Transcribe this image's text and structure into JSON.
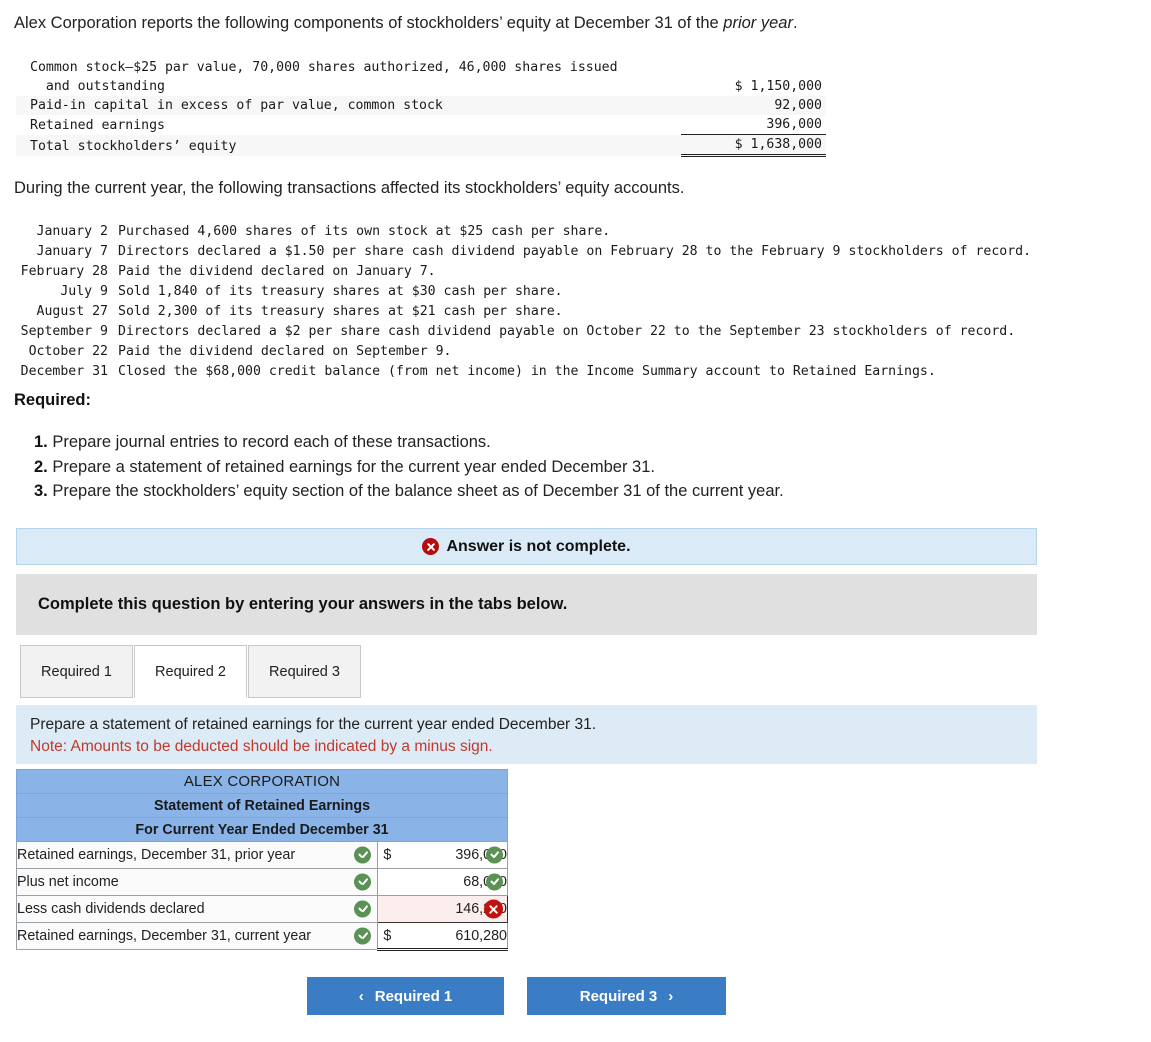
{
  "intro": {
    "text_before": "Alex Corporation reports the following components of stockholders’ equity at December 31 of the ",
    "italic": "prior year",
    "text_after": "."
  },
  "equity_table": {
    "rows": [
      {
        "label": "Common stock–$25 par value, 70,000 shares authorized, 46,000 shares issued",
        "amount": ""
      },
      {
        "label": "  and outstanding",
        "amount": "$ 1,150,000"
      },
      {
        "label": "Paid-in capital in excess of par value, common stock",
        "amount": "92,000"
      },
      {
        "label": "Retained earnings",
        "amount": "396,000"
      },
      {
        "label": "Total stockholders’ equity",
        "amount": "$ 1,638,000"
      }
    ]
  },
  "during_text": "During the current year, the following transactions affected its stockholders’ equity accounts.",
  "transactions": [
    {
      "date": "January 2",
      "desc": "Purchased 4,600 shares of its own stock at $25 cash per share."
    },
    {
      "date": "January 7",
      "desc": "Directors declared a $1.50 per share cash dividend payable on February 28 to the February 9 stockholders of record."
    },
    {
      "date": "February 28",
      "desc": "Paid the dividend declared on January 7."
    },
    {
      "date": "July 9",
      "desc": "Sold 1,840 of its treasury shares at $30 cash per share."
    },
    {
      "date": "August 27",
      "desc": "Sold 2,300 of its treasury shares at $21 cash per share."
    },
    {
      "date": "September 9",
      "desc": "Directors declared a $2 per share cash dividend payable on October 22 to the September 23 stockholders of record."
    },
    {
      "date": "October 22",
      "desc": "Paid the dividend declared on September 9."
    },
    {
      "date": "December 31",
      "desc": "Closed the $68,000 credit balance (from net income) in the Income Summary account to Retained Earnings."
    }
  ],
  "required": {
    "heading": "Required:",
    "items": [
      {
        "num": "1.",
        "text": "Prepare journal entries to record each of these transactions."
      },
      {
        "num": "2.",
        "text": "Prepare a statement of retained earnings for the current year ended December 31."
      },
      {
        "num": "3.",
        "text": "Prepare the stockholders’ equity section of the balance sheet as of December 31 of the current year."
      }
    ]
  },
  "alert": {
    "text": "Answer is not complete.",
    "icon": "x-circle-icon",
    "color": "#b50d0d"
  },
  "gray_bar": {
    "text": "Complete this question by entering your answers in the tabs below."
  },
  "tabs": [
    {
      "label": "Required 1",
      "active": false
    },
    {
      "label": "Required 2",
      "active": true
    },
    {
      "label": "Required 3",
      "active": false
    }
  ],
  "instruction": {
    "line1": "Prepare a statement of retained earnings for the current year ended December 31.",
    "note": "Note: Amounts to be deducted should be indicated by a minus sign."
  },
  "answer_table": {
    "header_color": "#8ab4e8",
    "titles": [
      "ALEX CORPORATION",
      "Statement of Retained Earnings",
      "For Current Year Ended December 31"
    ],
    "rows": [
      {
        "label": "Retained earnings, December 31, prior year",
        "label_mark": "check",
        "dollar": "$",
        "value": "396,000",
        "value_mark": "check",
        "style": "normal"
      },
      {
        "label": "Plus net income",
        "label_mark": "check",
        "dollar": "",
        "value": "68,000",
        "value_mark": "check",
        "style": "normal"
      },
      {
        "label": "Less cash dividends declared",
        "label_mark": "check",
        "dollar": "",
        "value": "146,280",
        "value_mark": "x",
        "style": "wrong"
      },
      {
        "label": "Retained earnings, December 31, current year",
        "label_mark": "check",
        "dollar": "$",
        "value": "610,280",
        "value_mark": "",
        "style": "total"
      }
    ]
  },
  "nav": {
    "prev_label": "Required 1",
    "prev_chevron": "‹",
    "next_label": "Required 3",
    "next_chevron": "›",
    "color": "#3b7dc4"
  }
}
